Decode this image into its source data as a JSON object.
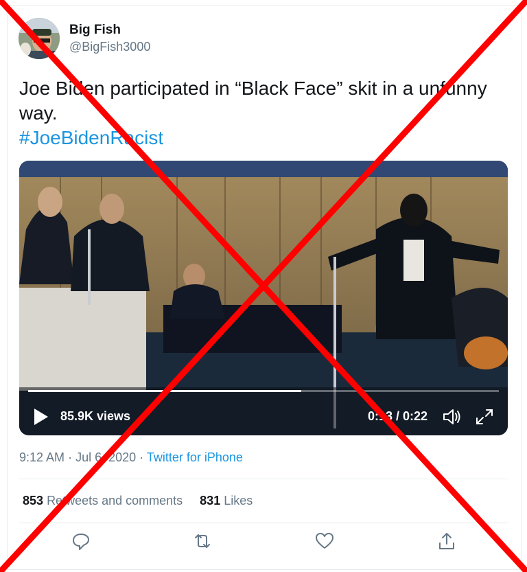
{
  "author": {
    "name": "Big Fish",
    "handle": "@BigFish3000"
  },
  "tweet": {
    "text": "Joe Biden participated in “Black Face” skit in a unfunny way.",
    "hashtag": "#JoeBidenRacist"
  },
  "video": {
    "views": "85.9K views",
    "time": "0:13 / 0:22",
    "progress": 0.58
  },
  "meta": {
    "time": "9:12 AM",
    "date": "Jul 6, 2020",
    "separator": "·",
    "source": "Twitter for iPhone"
  },
  "stats": {
    "retweets_count": "853",
    "retweets_label": "Retweets and comments",
    "likes_count": "831",
    "likes_label": "Likes"
  },
  "icons": {
    "reply": "comment-icon",
    "retweet": "retweet-icon",
    "like": "heart-icon",
    "share": "share-icon",
    "play": "play-icon",
    "volume": "volume-icon",
    "fullscreen": "expand-icon"
  },
  "colors": {
    "link": "#1b95e0",
    "secondary_text": "#657786",
    "overlay_cross": "#ff0000"
  }
}
